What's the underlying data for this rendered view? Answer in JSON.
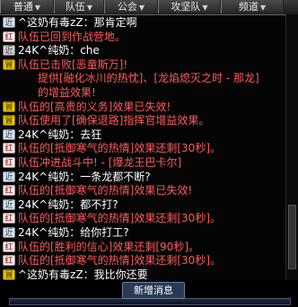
{
  "tabs": [
    {
      "label": "普通",
      "arrow": true
    },
    {
      "label": "队伍",
      "arrow": true
    },
    {
      "label": "公会",
      "arrow": true
    },
    {
      "label": "攻坚队",
      "arrow": true
    },
    {
      "label": "频道",
      "arrow": true
    }
  ],
  "messages": [
    {
      "badge": "near",
      "badge_label": "近",
      "text": "^这奶有毒zZ：那肯定啊",
      "color": "#ffffff"
    },
    {
      "badge": "team",
      "badge_label": "红",
      "text": "队伍已回到作战营地。",
      "color": "#ff5a5a"
    },
    {
      "badge": "adv",
      "badge_label": "近",
      "text": "24K^纯奶：che",
      "color": "#ffffff"
    },
    {
      "badge": "sys",
      "badge_label": "冒",
      "text": "队伍已击败[恶童斯万]!",
      "color": "#ff5a5a"
    },
    {
      "badge": "",
      "badge_label": "",
      "text": "提供[融化冰川的热忱]、[龙焰熄灭之时 - 那龙]",
      "color": "#ff5a5a"
    },
    {
      "badge": "",
      "badge_label": "",
      "text": "的增益效果!",
      "color": "#ff5a5a"
    },
    {
      "badge": "sys",
      "badge_label": "冒",
      "text": "队伍的[高贵的义务]效果已失效!",
      "color": "#ff5a5a"
    },
    {
      "badge": "sys",
      "badge_label": "冒",
      "text": "队伍使用了[确保退路]指挥官增益效果。",
      "color": "#ff5a5a"
    },
    {
      "badge": "near",
      "badge_label": "近",
      "text": "24K^纯奶：去狂",
      "color": "#ffffff"
    },
    {
      "badge": "team",
      "badge_label": "红",
      "text": "队伍的[抵御寒气的热情]效果还剩[30秒]。",
      "color": "#ff5a5a"
    },
    {
      "badge": "team",
      "badge_label": "红",
      "text": "队伍冲进战斗中! - [爆龙王巴卡尔]",
      "color": "#ff5a5a"
    },
    {
      "badge": "near",
      "badge_label": "近",
      "text": "24K^纯奶：一条龙都不断?",
      "color": "#ffffff"
    },
    {
      "badge": "team",
      "badge_label": "红",
      "text": "队伍的[抵御寒气的热情]效果已失效!",
      "color": "#ff5a5a"
    },
    {
      "badge": "near",
      "badge_label": "近",
      "text": "24K^纯奶：都不打?",
      "color": "#ffffff"
    },
    {
      "badge": "team",
      "badge_label": "红",
      "text": "队伍的[抵御寒气的热情]效果还剩[30秒]。",
      "color": "#ff5a5a"
    },
    {
      "badge": "near",
      "badge_label": "近",
      "text": "24K^纯奶：给你打工?",
      "color": "#ffffff"
    },
    {
      "badge": "team",
      "badge_label": "红",
      "text": "队伍的[胜利的信心]效果还剩[90秒]。",
      "color": "#ff5a5a"
    },
    {
      "badge": "team",
      "badge_label": "红",
      "text": "队伍的[抵御寒气的热情]效果还剩[30秒]。",
      "color": "#ff5a5a"
    },
    {
      "badge": "sys",
      "badge_label": "冒",
      "text": "^这奶有毒zZ：我比你还要",
      "color": "#ffffff"
    }
  ],
  "input": {
    "new_message_label": "新增消息"
  }
}
